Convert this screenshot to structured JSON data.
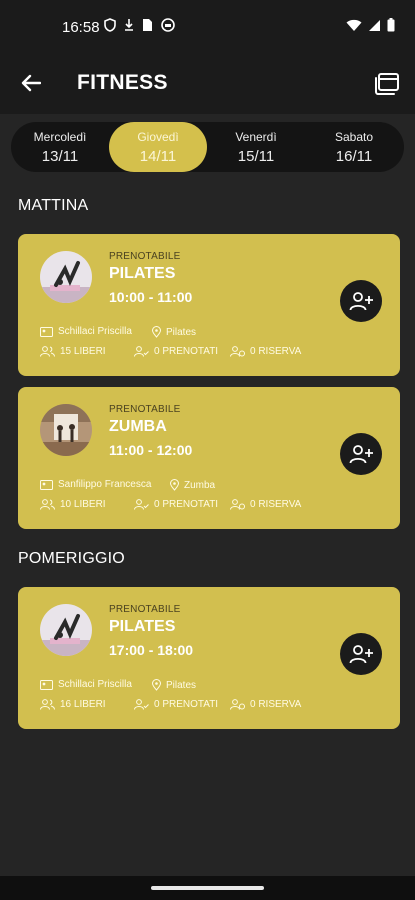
{
  "status_bar": {
    "time": "16:58"
  },
  "header": {
    "title": "FITNESS",
    "back_icon": "arrow-left-icon",
    "calendar_icon": "calendar-icon"
  },
  "days": [
    {
      "name": "Mercoledì",
      "date": "13/11",
      "active": false
    },
    {
      "name": "Giovedì",
      "date": "14/11",
      "active": true
    },
    {
      "name": "Venerdì",
      "date": "15/11",
      "active": false
    },
    {
      "name": "Sabato",
      "date": "16/11",
      "active": false
    }
  ],
  "sections": {
    "morning": "MATTINA",
    "afternoon": "POMERIGGIO"
  },
  "classes": [
    {
      "status": "PRENOTABILE",
      "name": "PILATES",
      "time": "10:00 - 11:00",
      "instructor": "Schillaci Priscilla",
      "room": "Pilates",
      "free": "15 LIBERI",
      "booked": "0 PRENOTATI",
      "reserve": "0 RISERVA"
    },
    {
      "status": "PRENOTABILE",
      "name": "ZUMBA",
      "time": "11:00 - 12:00",
      "instructor": "Sanfilippo Francesca",
      "room": "Zumba",
      "free": "10 LIBERI",
      "booked": "0 PRENOTATI",
      "reserve": "0 RISERVA"
    },
    {
      "status": "PRENOTABILE",
      "name": "PILATES",
      "time": "17:00 - 18:00",
      "instructor": "Schillaci Priscilla",
      "room": "Pilates",
      "free": "16 LIBERI",
      "booked": "0 PRENOTATI",
      "reserve": "0 RISERVA"
    }
  ],
  "colors": {
    "accent": "#d2bf4f",
    "background": "#252525",
    "bar": "#1b1b1b"
  }
}
